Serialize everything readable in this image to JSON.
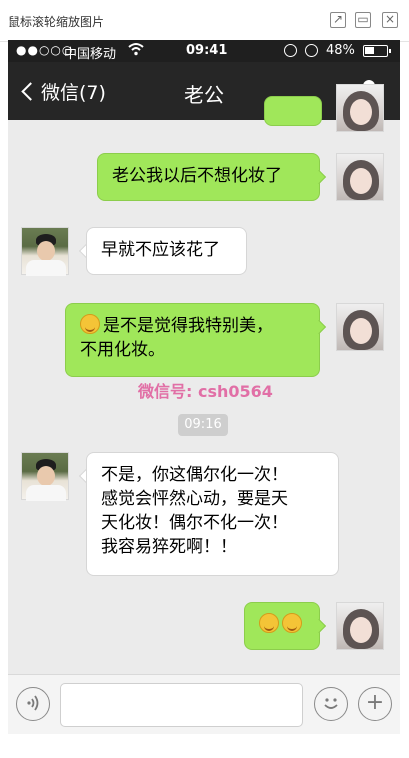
{
  "viewer": {
    "title": "鼠标滚轮缩放图片",
    "icons": [
      "open-external-icon",
      "maximize-icon",
      "close-icon"
    ]
  },
  "status_bar": {
    "signal": "●●○○○",
    "carrier": "中国移动",
    "time": "09:41",
    "battery_percent": "48%",
    "battery_level": 0.48
  },
  "nav": {
    "back_label": "微信(7)",
    "title": "老公"
  },
  "chat": {
    "timestamp": "09:16",
    "watermark_line": "微信号: csh0564",
    "messages": [
      {
        "sender": "me",
        "text": "老公我以后不想化妆了"
      },
      {
        "sender": "him",
        "text": "早就不应该花了"
      },
      {
        "sender": "me",
        "text": "是不是觉得我特别美，\n不用化妆。",
        "emoji_prefix": true
      },
      {
        "sender": "him",
        "text": "不是，你这偶尔化一次！\n感觉会怦然心动，要是天\n天化妆！偶尔不化一次！\n我容易猝死啊！！"
      },
      {
        "sender": "me",
        "text": "",
        "emoji_count": 2
      }
    ]
  },
  "input_bar": {
    "icons": [
      "voice-icon",
      "emoji-icon",
      "plus-icon"
    ]
  },
  "colors": {
    "sent_bubble": "#a0e75a",
    "received_bubble": "#ffffff",
    "nav_bg": "#262626",
    "chat_bg": "#ebebeb"
  }
}
